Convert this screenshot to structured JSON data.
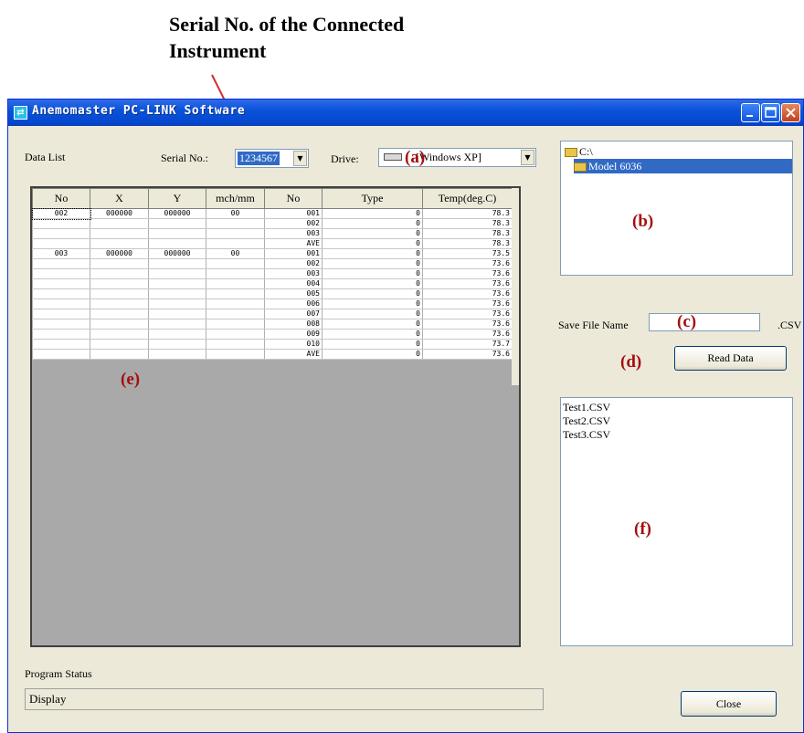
{
  "annotation": {
    "callout_line1": "Serial No. of the Connected",
    "callout_line2": "Instrument",
    "labels": {
      "a": "(a)",
      "b": "(b)",
      "c": "(c)",
      "d": "(d)",
      "e": "(e)",
      "f": "(f)"
    },
    "label_color": "#a50e0e"
  },
  "window": {
    "title": "Anemomaster PC-LINK Software",
    "title_icon": "app-icon",
    "controls": [
      "minimize-icon",
      "maximize-icon",
      "close-icon"
    ]
  },
  "data_list": {
    "label": "Data List",
    "serial_label": "Serial No.:",
    "serial_value": "1234567",
    "drive_label": "Drive:",
    "drive_value": "[Windows XP]",
    "columns": [
      "No",
      "X",
      "Y",
      "mch/mm",
      "No",
      "Type",
      "Temp(deg.C)"
    ],
    "rows": [
      [
        "002",
        "000000",
        "000000",
        "00",
        "001",
        "0",
        "78.3"
      ],
      [
        "",
        "",
        "",
        "",
        "002",
        "0",
        "78.3"
      ],
      [
        "",
        "",
        "",
        "",
        "003",
        "0",
        "78.3"
      ],
      [
        "",
        "",
        "",
        "",
        "AVE",
        "0",
        "78.3"
      ],
      [
        "003",
        "000000",
        "000000",
        "00",
        "001",
        "0",
        "73.5"
      ],
      [
        "",
        "",
        "",
        "",
        "002",
        "0",
        "73.6"
      ],
      [
        "",
        "",
        "",
        "",
        "003",
        "0",
        "73.6"
      ],
      [
        "",
        "",
        "",
        "",
        "004",
        "0",
        "73.6"
      ],
      [
        "",
        "",
        "",
        "",
        "005",
        "0",
        "73.6"
      ],
      [
        "",
        "",
        "",
        "",
        "006",
        "0",
        "73.6"
      ],
      [
        "",
        "",
        "",
        "",
        "007",
        "0",
        "73.6"
      ],
      [
        "",
        "",
        "",
        "",
        "008",
        "0",
        "73.6"
      ],
      [
        "",
        "",
        "",
        "",
        "009",
        "0",
        "73.6"
      ],
      [
        "",
        "",
        "",
        "",
        "010",
        "0",
        "73.7"
      ],
      [
        "",
        "",
        "",
        "",
        "AVE",
        "0",
        "73.6"
      ]
    ]
  },
  "folder_tree": {
    "items": [
      "C:\\",
      "Model 6036"
    ],
    "selected": "Model 6036"
  },
  "save": {
    "label": "Save File Name",
    "value": "",
    "extension": ".CSV",
    "read_button": "Read Data"
  },
  "file_list": [
    "Test1.CSV",
    "Test2.CSV",
    "Test3.CSV"
  ],
  "status": {
    "label": "Program Status",
    "value": "Display"
  },
  "close_button": "Close"
}
